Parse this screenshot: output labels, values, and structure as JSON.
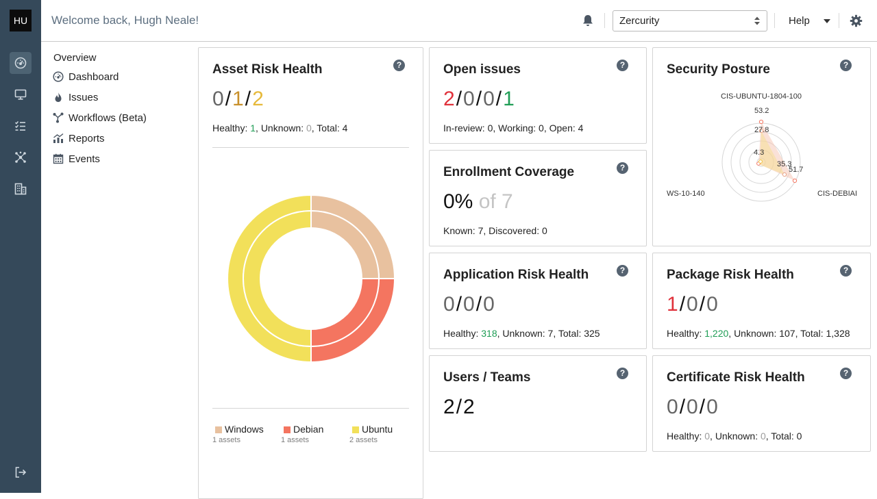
{
  "user": {
    "initials": "HU"
  },
  "header": {
    "welcome": "Welcome back, Hugh Neale!",
    "org_selected": "Zercurity",
    "help_label": "Help"
  },
  "rail": {
    "icons": [
      "dashboard-icon",
      "desktop-icon",
      "checklist-icon",
      "network-icon",
      "buildings-icon",
      "logout-icon"
    ]
  },
  "subnav": {
    "title": "Overview",
    "items": [
      {
        "label": "Dashboard",
        "icon": "dashboard-icon"
      },
      {
        "label": "Issues",
        "icon": "flame-icon"
      },
      {
        "label": "Workflows (Beta)",
        "icon": "workflow-icon"
      },
      {
        "label": "Reports",
        "icon": "chart-icon"
      },
      {
        "label": "Events",
        "icon": "calendar-icon"
      }
    ]
  },
  "help_glyph": "?",
  "separator": "/",
  "asset_risk": {
    "title": "Asset Risk Health",
    "values": [
      "0",
      "1",
      "2"
    ],
    "label_healthy": "Healthy: ",
    "healthy": "1",
    "label_unknown": ", Unknown: ",
    "unknown": "0",
    "label_total": ", Total: ",
    "total": "4",
    "legend": [
      {
        "name": "Windows",
        "count": "1 assets",
        "color": "#e8c19f"
      },
      {
        "name": "Debian",
        "count": "1 assets",
        "color": "#f47560"
      },
      {
        "name": "Ubuntu",
        "count": "2 assets",
        "color": "#f2e05a"
      }
    ]
  },
  "chart_data": {
    "type": "pie",
    "categories": [
      "Windows",
      "Debian",
      "Ubuntu"
    ],
    "values": [
      1,
      1,
      2
    ],
    "colors": [
      "#e8c19f",
      "#f47560",
      "#f2e05a"
    ]
  },
  "open_issues": {
    "title": "Open issues",
    "values": [
      "2",
      "0",
      "0",
      "1"
    ],
    "label_review": "In-review: ",
    "review": "0",
    "label_working": ", Working: ",
    "working": "0",
    "label_open": ", Open: ",
    "open": "4"
  },
  "security_posture": {
    "title": "Security Posture",
    "axis_top": "CIS-UBUNTU-1804-100",
    "axis_left": "WS-10-140",
    "axis_right": "CIS-DEBIAI",
    "rings": [
      "53.2",
      "27.8",
      "4.3",
      "35.3",
      "51.7"
    ]
  },
  "enrollment": {
    "title": "Enrollment Coverage",
    "percent": "0%",
    "of_total": "of 7",
    "label_known": "Known: ",
    "known": "7",
    "label_discovered": ", Discovered: ",
    "discovered": "0"
  },
  "app_risk": {
    "title": "Application Risk Health",
    "values": [
      "0",
      "0",
      "0"
    ],
    "label_healthy": "Healthy: ",
    "healthy": "318",
    "label_unknown": ", Unknown: ",
    "unknown": "7",
    "label_total": ", Total: ",
    "total": "325"
  },
  "pkg_risk": {
    "title": "Package Risk Health",
    "values": [
      "1",
      "0",
      "0"
    ],
    "label_healthy": "Healthy: ",
    "healthy": "1,220",
    "label_unknown": ", Unknown: ",
    "unknown": "107",
    "label_total": ", Total: ",
    "total": "1,328"
  },
  "users_teams": {
    "title": "Users / Teams",
    "users": "2",
    "teams": "2"
  },
  "cert_risk": {
    "title": "Certificate Risk Health",
    "values": [
      "0",
      "0",
      "0"
    ],
    "label_healthy": "Healthy: ",
    "healthy": "0",
    "label_unknown": ", Unknown: ",
    "unknown": "0",
    "label_total": ", Total: ",
    "total": "0"
  }
}
